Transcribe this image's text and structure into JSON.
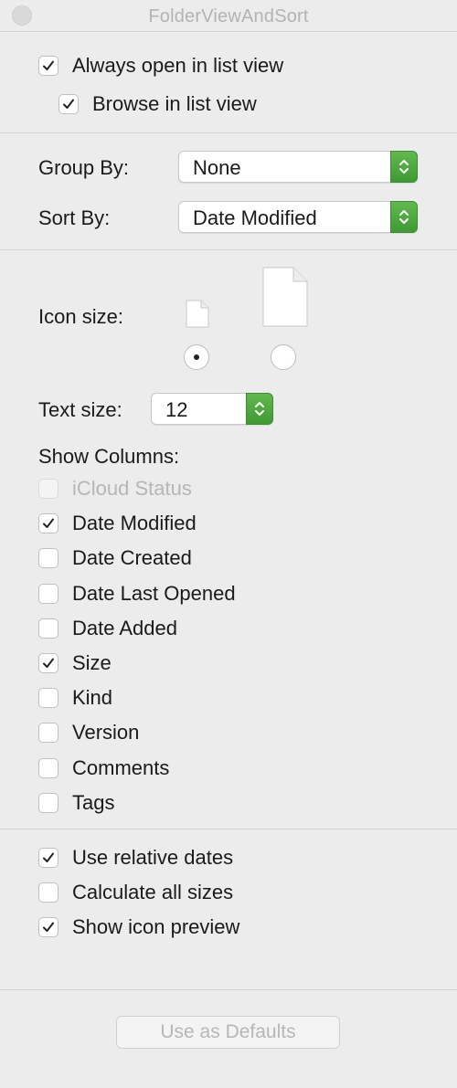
{
  "window": {
    "title": "FolderViewAndSort"
  },
  "options": {
    "always_open_list": {
      "label": "Always open in list view",
      "checked": true
    },
    "browse_list": {
      "label": "Browse in list view",
      "checked": true
    }
  },
  "grouping": {
    "group_by_label": "Group By:",
    "group_by_value": "None",
    "sort_by_label": "Sort By:",
    "sort_by_value": "Date Modified"
  },
  "icon_size": {
    "label": "Icon size:",
    "selected": "small"
  },
  "text_size": {
    "label": "Text size:",
    "value": "12"
  },
  "columns": {
    "heading": "Show Columns:",
    "items": [
      {
        "label": "iCloud Status",
        "checked": false,
        "disabled": true
      },
      {
        "label": "Date Modified",
        "checked": true,
        "disabled": false
      },
      {
        "label": "Date Created",
        "checked": false,
        "disabled": false
      },
      {
        "label": "Date Last Opened",
        "checked": false,
        "disabled": false
      },
      {
        "label": "Date Added",
        "checked": false,
        "disabled": false
      },
      {
        "label": "Size",
        "checked": true,
        "disabled": false
      },
      {
        "label": "Kind",
        "checked": false,
        "disabled": false
      },
      {
        "label": "Version",
        "checked": false,
        "disabled": false
      },
      {
        "label": "Comments",
        "checked": false,
        "disabled": false
      },
      {
        "label": "Tags",
        "checked": false,
        "disabled": false
      }
    ]
  },
  "extras": [
    {
      "label": "Use relative dates",
      "checked": true
    },
    {
      "label": "Calculate all sizes",
      "checked": false
    },
    {
      "label": "Show icon preview",
      "checked": true
    }
  ],
  "footer": {
    "defaults_label": "Use as Defaults"
  },
  "colors": {
    "accent_green": "#4aa63c",
    "background": "#ececec"
  }
}
